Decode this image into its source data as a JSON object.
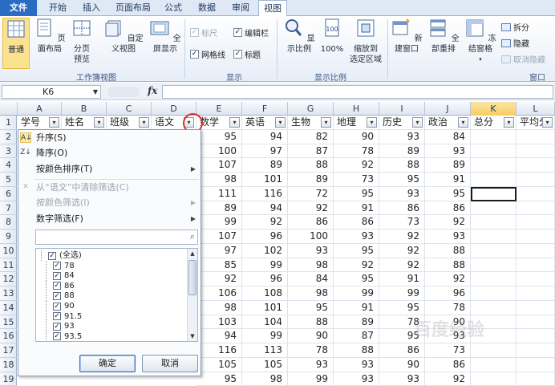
{
  "ribbon_tabs": [
    "文件",
    "开始",
    "插入",
    "页面布局",
    "公式",
    "数据",
    "审阅",
    "视图"
  ],
  "ribbon": {
    "workbook_views": {
      "label": "工作簿视图",
      "buttons": [
        "普通",
        "页面布局",
        "分页\n预览",
        "自定义视图",
        "全屏显示"
      ]
    },
    "show": {
      "label": "显示",
      "checks": [
        {
          "text": "标尺",
          "checked": true,
          "disabled": true
        },
        {
          "text": "编辑栏",
          "checked": true
        },
        {
          "text": "网格线",
          "checked": true
        },
        {
          "text": "标题",
          "checked": true
        }
      ]
    },
    "zoom": {
      "label": "显示比例",
      "buttons": [
        "显示比例",
        "100%",
        "缩放到\n选定区域"
      ]
    },
    "window": {
      "label": "窗口",
      "buttons": [
        "新建窗口",
        "全部重排",
        "冻结窗格"
      ],
      "small": [
        "拆分",
        "隐藏",
        "取消隐藏"
      ]
    }
  },
  "formula_bar": {
    "name_box": "K6",
    "fx": "fx",
    "value": ""
  },
  "columns": [
    "A",
    "B",
    "C",
    "D",
    "E",
    "F",
    "G",
    "H",
    "I",
    "J",
    "K",
    "L"
  ],
  "selected_column": "K",
  "headers": [
    "学号",
    "姓名",
    "班级",
    "语文",
    "数学",
    "英语",
    "生物",
    "地理",
    "历史",
    "政治",
    "总分",
    "平均分"
  ],
  "rows": [
    [
      95,
      94,
      82,
      90,
      93,
      84
    ],
    [
      100,
      97,
      87,
      78,
      89,
      93
    ],
    [
      107,
      89,
      88,
      92,
      88,
      89
    ],
    [
      98,
      101,
      89,
      73,
      95,
      91
    ],
    [
      111,
      116,
      72,
      95,
      93,
      95
    ],
    [
      89,
      94,
      92,
      91,
      86,
      86
    ],
    [
      99,
      92,
      86,
      86,
      73,
      92
    ],
    [
      107,
      96,
      100,
      93,
      92,
      93
    ],
    [
      97,
      102,
      93,
      95,
      92,
      88
    ],
    [
      85,
      99,
      98,
      92,
      92,
      88
    ],
    [
      92,
      96,
      84,
      95,
      91,
      92
    ],
    [
      106,
      108,
      98,
      99,
      99,
      96
    ],
    [
      98,
      101,
      95,
      91,
      95,
      78
    ],
    [
      103,
      104,
      88,
      89,
      78,
      90
    ],
    [
      94,
      99,
      90,
      87,
      95,
      93
    ],
    [
      116,
      113,
      78,
      88,
      86,
      73
    ],
    [
      105,
      105,
      93,
      93,
      90,
      86
    ],
    [
      95,
      98,
      99,
      93,
      93,
      92
    ]
  ],
  "filter_menu": {
    "items": [
      {
        "label": "升序(S)",
        "icon": "sort-asc-icon"
      },
      {
        "label": "降序(O)",
        "icon": "sort-desc-icon"
      },
      {
        "label": "按颜色排序(T)",
        "submenu": true
      },
      {
        "label": "从“语文”中清除筛选(C)",
        "icon": "clear-filter-icon",
        "disabled": true
      },
      {
        "label": "按颜色筛选(I)",
        "submenu": true,
        "disabled": true
      },
      {
        "label": "数字筛选(F)",
        "submenu": true
      }
    ],
    "search_placeholder": "",
    "values": [
      "(全选)",
      "78",
      "84",
      "86",
      "88",
      "90",
      "91.5",
      "93",
      "93.5"
    ],
    "ok": "确定",
    "cancel": "取消"
  },
  "watermark": "百度经验"
}
